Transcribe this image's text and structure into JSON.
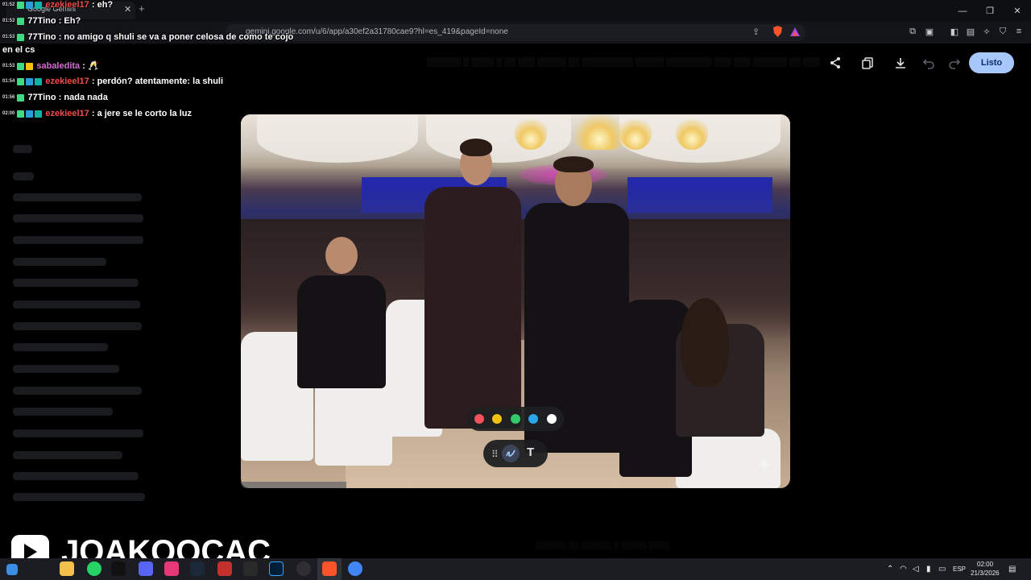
{
  "browser": {
    "tab_title": "Google Gemini",
    "url": "gemini.google.com/u/6/app/a30ef2a31780cae9?hl=es_419&pageId=none"
  },
  "editor": {
    "done_label": "Listo",
    "tools": [
      "share-icon",
      "copy-icon",
      "download-icon",
      "undo-icon",
      "redo-icon"
    ],
    "palette_colors": [
      "#f0535e",
      "#f4c20d",
      "#34c96b",
      "#2aa7e8",
      "#ffffff"
    ],
    "tool_text_label": "T"
  },
  "chat": [
    {
      "time": "01:52",
      "user": "ezekieel17",
      "user_color": "#f04b4b",
      "message": ": eh?"
    },
    {
      "time": "01:53",
      "user": "77Tino",
      "user_color": "#ffffff",
      "message": ": Eh?"
    },
    {
      "time": "01:53",
      "user": "77Tino",
      "user_color": "#ffffff",
      "message": ": no amigo q shuli se va a poner celosa de como te cojo"
    },
    {
      "time": "",
      "user": "",
      "user_color": "#ffffff",
      "message": "en el cs"
    },
    {
      "time": "01:53",
      "user": "sabaledita",
      "user_color": "#d66bd6",
      "message": ": 🥂"
    },
    {
      "time": "01:54",
      "user": "ezekieel17",
      "user_color": "#f04b4b",
      "message": ": perdón? atentamente: la shuli"
    },
    {
      "time": "01:56",
      "user": "77Tino",
      "user_color": "#ffffff",
      "message": ": nada nada"
    },
    {
      "time": "02:00",
      "user": "ezekieel17",
      "user_color": "#f04b4b",
      "message": ": a jere se le corto la luz"
    }
  ],
  "branding": {
    "channel_name": "JOAKOOCAC"
  },
  "taskbar": {
    "lang": "ESP",
    "time": "02:00",
    "date": "21/3/2026"
  }
}
